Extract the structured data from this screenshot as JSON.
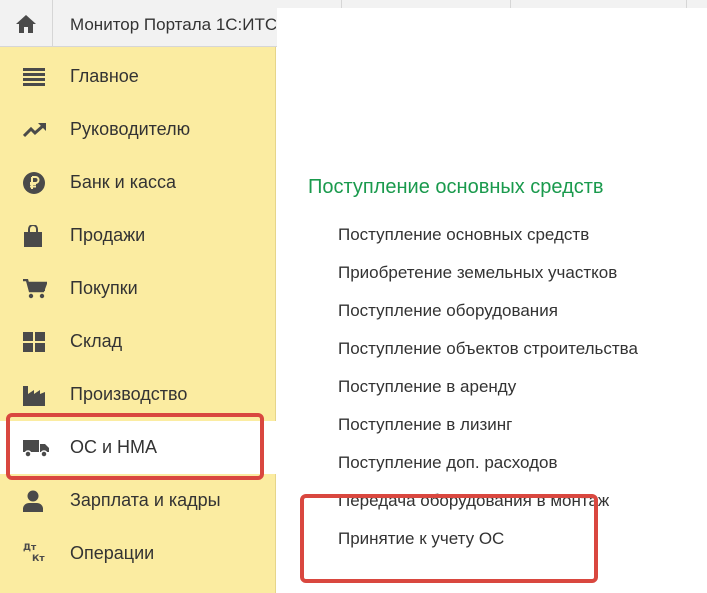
{
  "tab": {
    "title": "Монитор Портала 1С:ИТС"
  },
  "sidebar": {
    "items": [
      {
        "label": "Главное",
        "icon": "hamburger-menu-icon"
      },
      {
        "label": "Руководителю",
        "icon": "trend-up-icon"
      },
      {
        "label": "Банк и касса",
        "icon": "ruble-coin-icon"
      },
      {
        "label": "Продажи",
        "icon": "shopping-bag-icon"
      },
      {
        "label": "Покупки",
        "icon": "shopping-cart-icon"
      },
      {
        "label": "Склад",
        "icon": "warehouse-grid-icon"
      },
      {
        "label": "Производство",
        "icon": "factory-icon"
      },
      {
        "label": "ОС и НМА",
        "icon": "truck-icon",
        "active": true
      },
      {
        "label": "Зарплата и кадры",
        "icon": "person-icon"
      },
      {
        "label": "Операции",
        "icon": "debit-credit-icon",
        "icon_text_top": "Дт",
        "icon_text_bottom": "Кт"
      }
    ]
  },
  "content": {
    "section_title": "Поступление основных средств",
    "links": [
      "Поступление основных средств",
      "Приобретение земельных участков",
      "Поступление оборудования",
      "Поступление объектов строительства",
      "Поступление в аренду",
      "Поступление в лизинг",
      "Поступление доп. расходов",
      "Передача оборудования в монтаж",
      "Принятие к учету ОС"
    ]
  },
  "colors": {
    "sidebar_bg": "#fbeca1",
    "section_title": "#1a9a4d",
    "highlight": "#d9473f",
    "text": "#333333",
    "icon": "#4a4a4a"
  }
}
